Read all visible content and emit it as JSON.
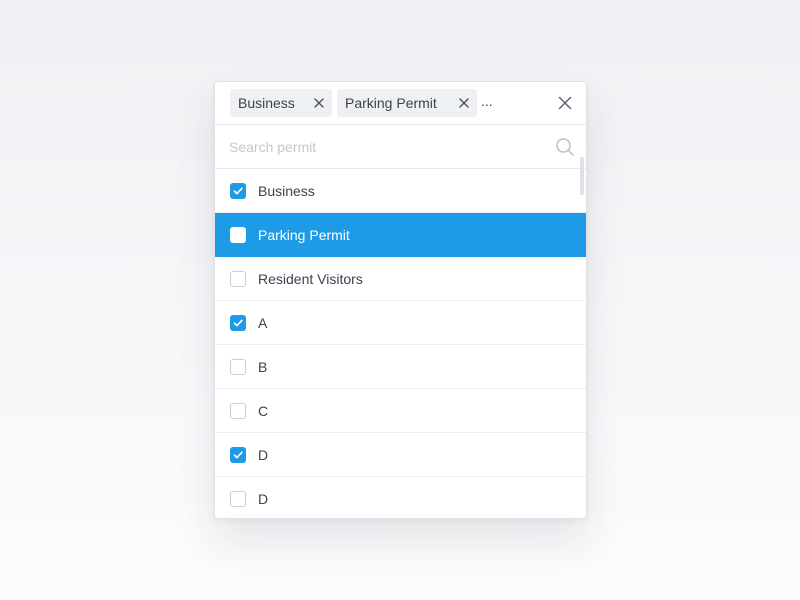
{
  "selected_tags": [
    {
      "label": "Business"
    },
    {
      "label": "Parking Permit"
    }
  ],
  "overflow_indicator": "...",
  "search": {
    "placeholder": "Search permit",
    "value": ""
  },
  "options": [
    {
      "label": "Business",
      "checked": true,
      "highlighted": false
    },
    {
      "label": "Parking Permit",
      "checked": false,
      "highlighted": true
    },
    {
      "label": "Resident Visitors",
      "checked": false,
      "highlighted": false
    },
    {
      "label": "A",
      "checked": true,
      "highlighted": false
    },
    {
      "label": "B",
      "checked": false,
      "highlighted": false
    },
    {
      "label": "C",
      "checked": false,
      "highlighted": false
    },
    {
      "label": "D",
      "checked": true,
      "highlighted": false
    },
    {
      "label": "D",
      "checked": false,
      "highlighted": false
    }
  ],
  "colors": {
    "accent": "#1e9be6",
    "text": "#3b4250",
    "chip_background": "#eef0f3",
    "placeholder": "#c3c8d0"
  },
  "icons": {
    "chip_remove": "close-icon",
    "clear_all": "close-icon",
    "search": "search-icon",
    "check": "checkmark-icon"
  }
}
